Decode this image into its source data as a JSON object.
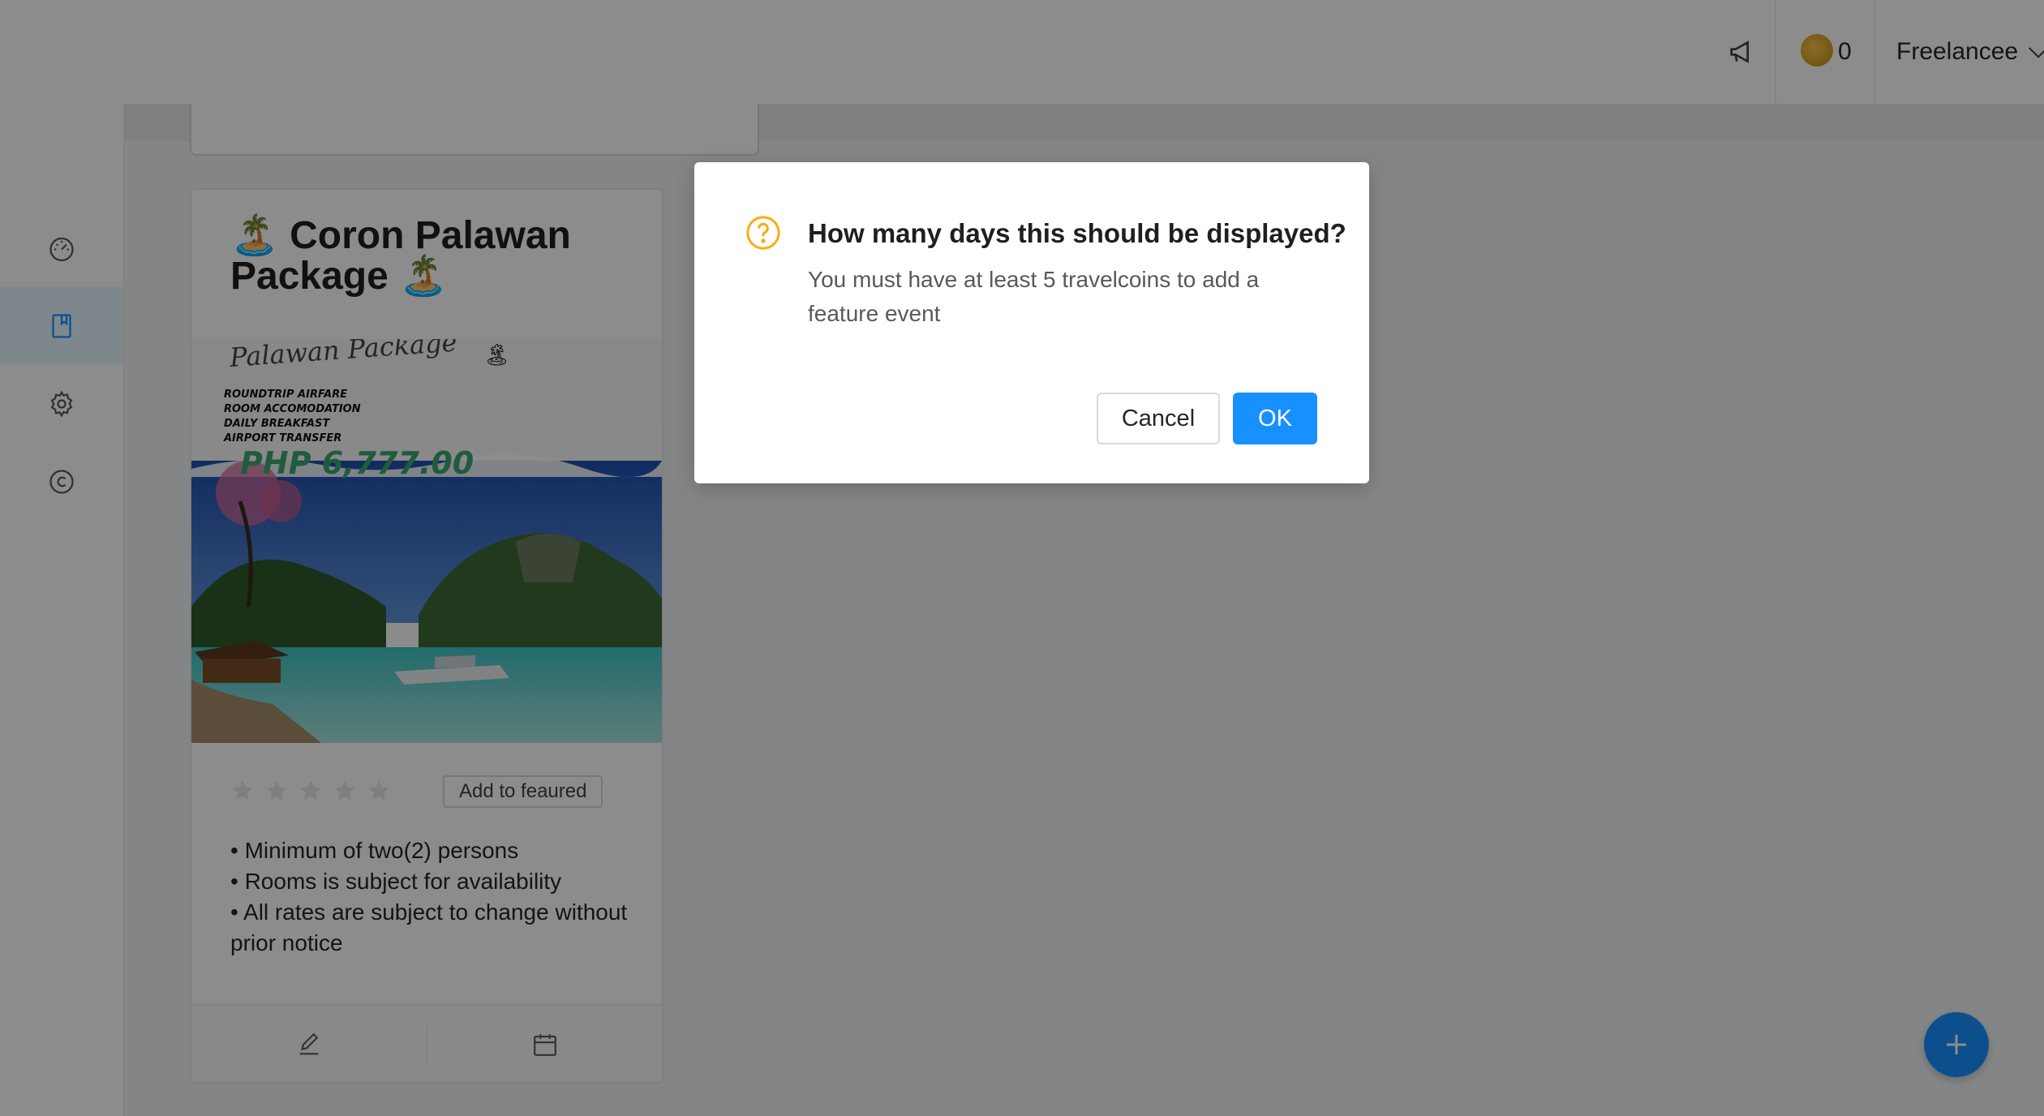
{
  "sidebar": {
    "items": [
      {
        "icon": "dashboard-icon"
      },
      {
        "icon": "bookmark-icon",
        "active": true
      },
      {
        "icon": "settings-icon"
      },
      {
        "icon": "copyright-icon"
      }
    ]
  },
  "header": {
    "notification_icon": "megaphone-icon",
    "coin_count": "0",
    "user_name": "Freelancee"
  },
  "card": {
    "title": "🏝️ Coron Palawan Package 🏝️",
    "rating": 0,
    "rating_max": 5,
    "feature_button": "Add to feaured",
    "description": [
      "• Minimum of two(2) persons",
      "• Rooms is subject for availability",
      "• All rates are subject to change without prior notice"
    ],
    "poster": {
      "script_title": "Palawan Package",
      "lines": [
        "ROUNDTRIP AIRFARE",
        "ROOM ACCOMODATION",
        "DAILY BREAKFAST",
        "AIRPORT TRANSFER"
      ],
      "price": "PHP 6,777.00"
    }
  },
  "modal": {
    "title": "How many days this should be displayed?",
    "content": "You must have at least 5 travelcoins to add a feature event",
    "cancel_label": "Cancel",
    "ok_label": "OK"
  },
  "colors": {
    "primary": "#1890ff",
    "warning": "#faad14",
    "coin": "#e0a21d"
  }
}
